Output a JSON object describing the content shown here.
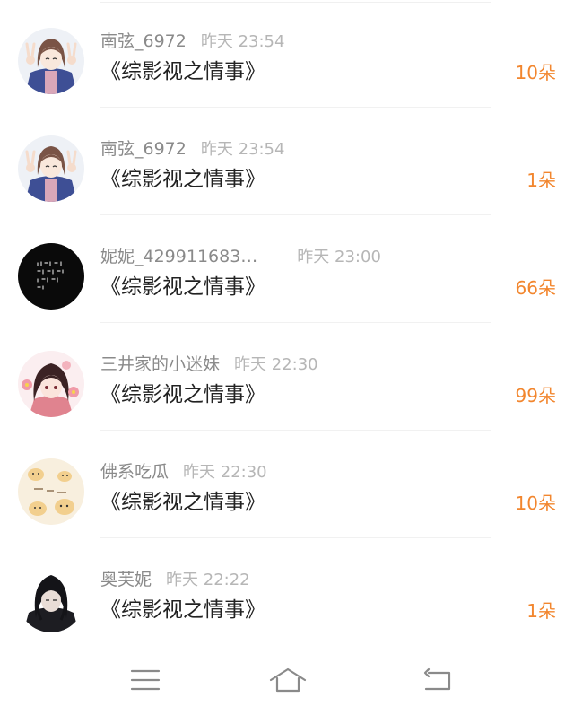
{
  "items": [
    {
      "username": "南弦_6972",
      "time": "昨天 23:54",
      "title": "《综影视之情事》",
      "flowers": "10朵",
      "avatar": "girl-peace-sign-avatar"
    },
    {
      "username": "南弦_6972",
      "time": "昨天 23:54",
      "title": "《综影视之情事》",
      "flowers": "1朵",
      "avatar": "girl-peace-sign-avatar"
    },
    {
      "username": "妮妮_429911683…",
      "time": "昨天 23:00",
      "title": "《综影视之情事》",
      "flowers": "66朵",
      "avatar": "black-text-avatar"
    },
    {
      "username": "三井家的小迷妹",
      "time": "昨天 22:30",
      "title": "《综影视之情事》",
      "flowers": "99朵",
      "avatar": "anime-girl-flowers-avatar"
    },
    {
      "username": "佛系吃瓜",
      "time": "昨天 22:30",
      "title": "《综影视之情事》",
      "flowers": "10朵",
      "avatar": "cartoon-cats-avatar"
    },
    {
      "username": "奥芙妮",
      "time": "昨天 22:22",
      "title": "《综影视之情事》",
      "flowers": "1朵",
      "avatar": "dark-haired-man-avatar"
    }
  ],
  "navbar": {
    "menu_icon": "menu-icon",
    "home_icon": "home-icon",
    "back_icon": "back-icon"
  },
  "colors": {
    "flowers": "#f2862e",
    "username": "#8a8a8a",
    "time": "#b6b6b6",
    "title": "#222222"
  }
}
